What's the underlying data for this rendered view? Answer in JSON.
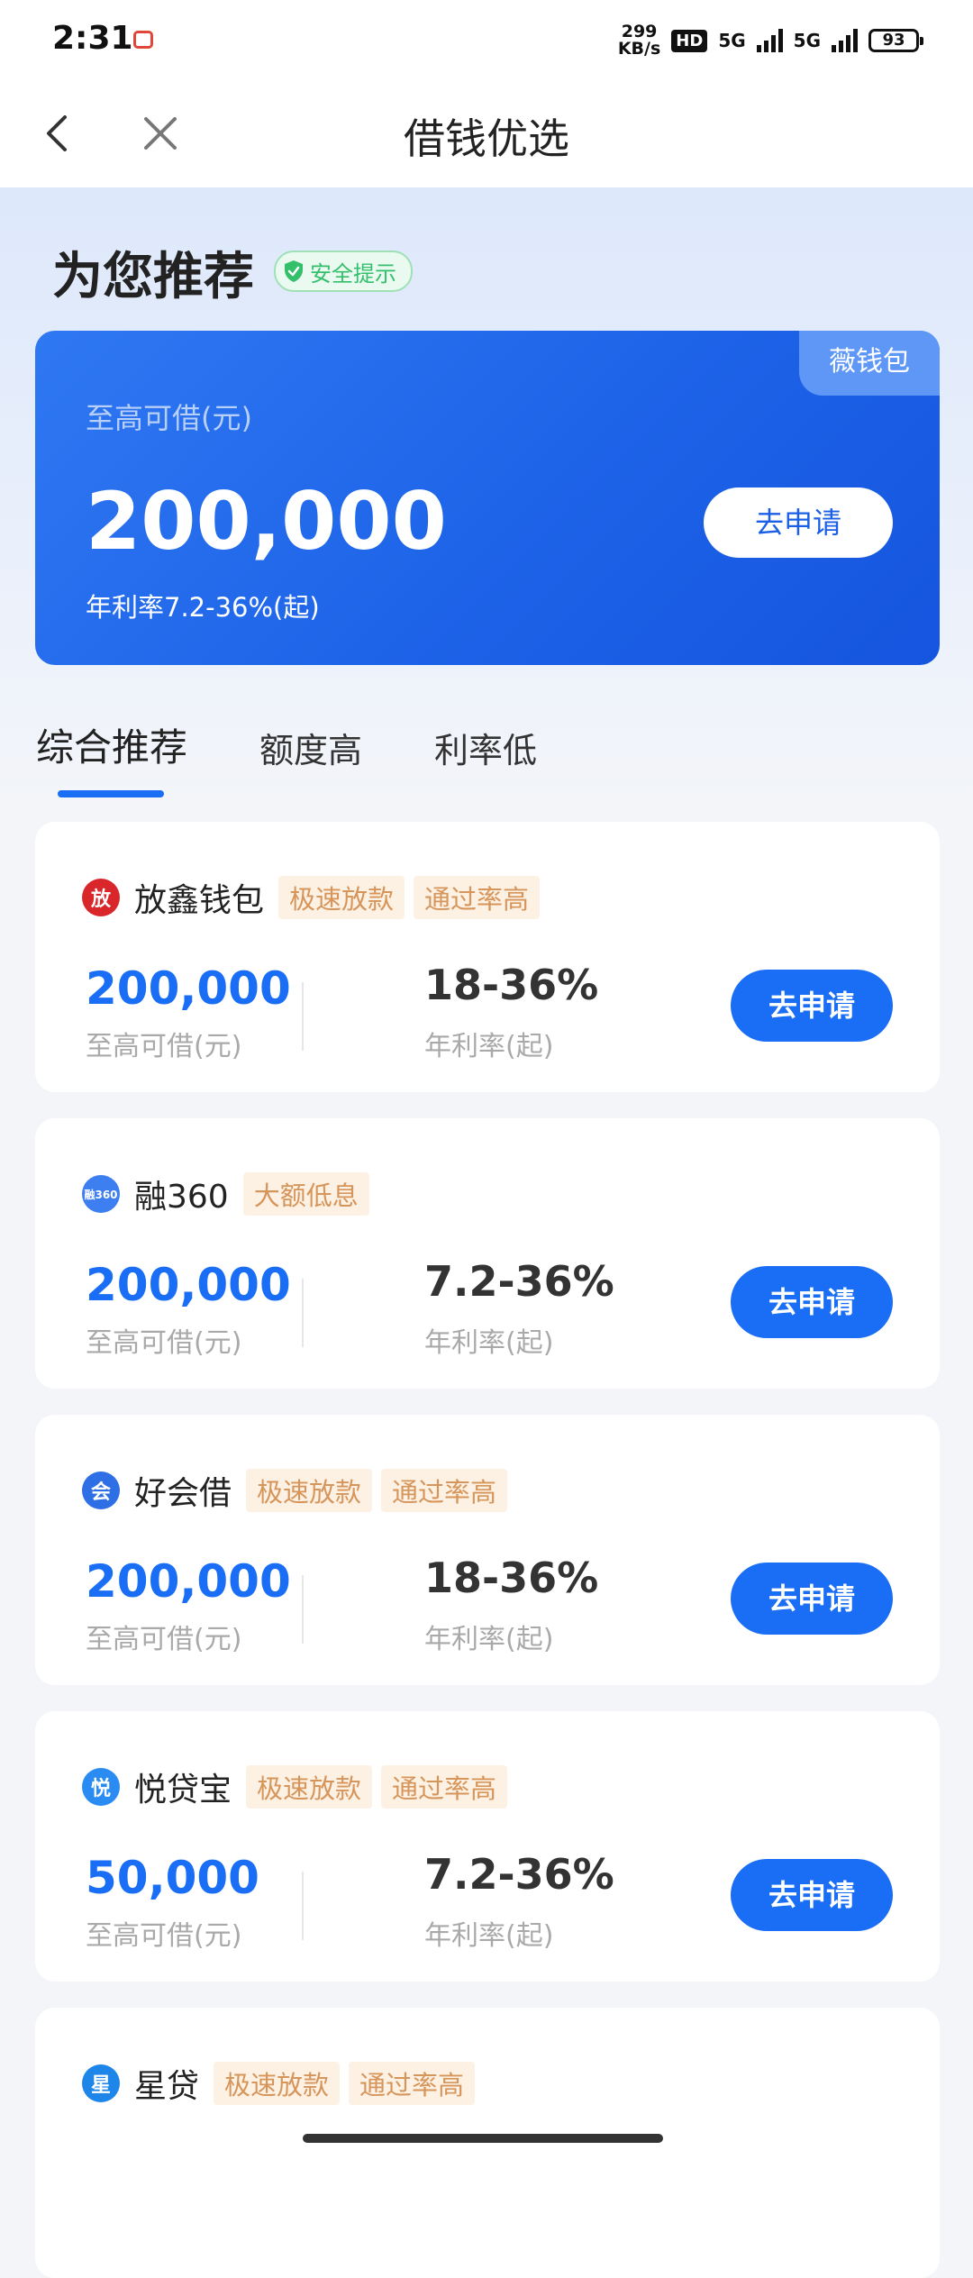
{
  "status": {
    "time": "2:31",
    "speed_top": "299",
    "speed_bottom": "KB/s",
    "hd": "HD",
    "net1": "5G",
    "net2": "5G",
    "battery": "93"
  },
  "nav": {
    "title": "借钱优选"
  },
  "hero": {
    "heading": "为您推荐",
    "safety_label": "安全提示",
    "banner": {
      "tag": "薇钱包",
      "subtitle": "至高可借(元)",
      "amount": "200,000",
      "rate": "年利率7.2-36%(起)",
      "apply_label": "去申请"
    }
  },
  "tabs": [
    "综合推荐",
    "额度高",
    "利率低"
  ],
  "active_tab": "综合推荐",
  "cards": [
    {
      "name": "放鑫钱包",
      "logo": "放",
      "logo_color": "#d9262b",
      "badges": [
        "极速放款",
        "通过率高"
      ],
      "amount": "200,000",
      "amount_label": "至高可借(元)",
      "rate": "18-36%",
      "rate_label": "年利率(起)",
      "button": "去申请"
    },
    {
      "name": "融360",
      "logo": "融360",
      "logo_color": "#3d7ff0",
      "badges": [
        "大额低息"
      ],
      "amount": "200,000",
      "amount_label": "至高可借(元)",
      "rate": "7.2-36%",
      "rate_label": "年利率(起)",
      "button": "去申请"
    },
    {
      "name": "好会借",
      "logo": "会",
      "logo_color": "#2e6fe6",
      "badges": [
        "极速放款",
        "通过率高"
      ],
      "amount": "200,000",
      "amount_label": "至高可借(元)",
      "rate": "18-36%",
      "rate_label": "年利率(起)",
      "button": "去申请"
    },
    {
      "name": "悦贷宝",
      "logo": "悦",
      "logo_color": "#2a8cf2",
      "badges": [
        "极速放款",
        "通过率高"
      ],
      "amount": "50,000",
      "amount_label": "至高可借(元)",
      "rate": "7.2-36%",
      "rate_label": "年利率(起)",
      "button": "去申请"
    },
    {
      "name": "星贷",
      "logo": "星",
      "logo_color": "#1e86e8",
      "badges": [
        "极速放款",
        "通过率高"
      ],
      "amount": "",
      "amount_label": "",
      "rate": "",
      "rate_label": "",
      "button": ""
    }
  ]
}
